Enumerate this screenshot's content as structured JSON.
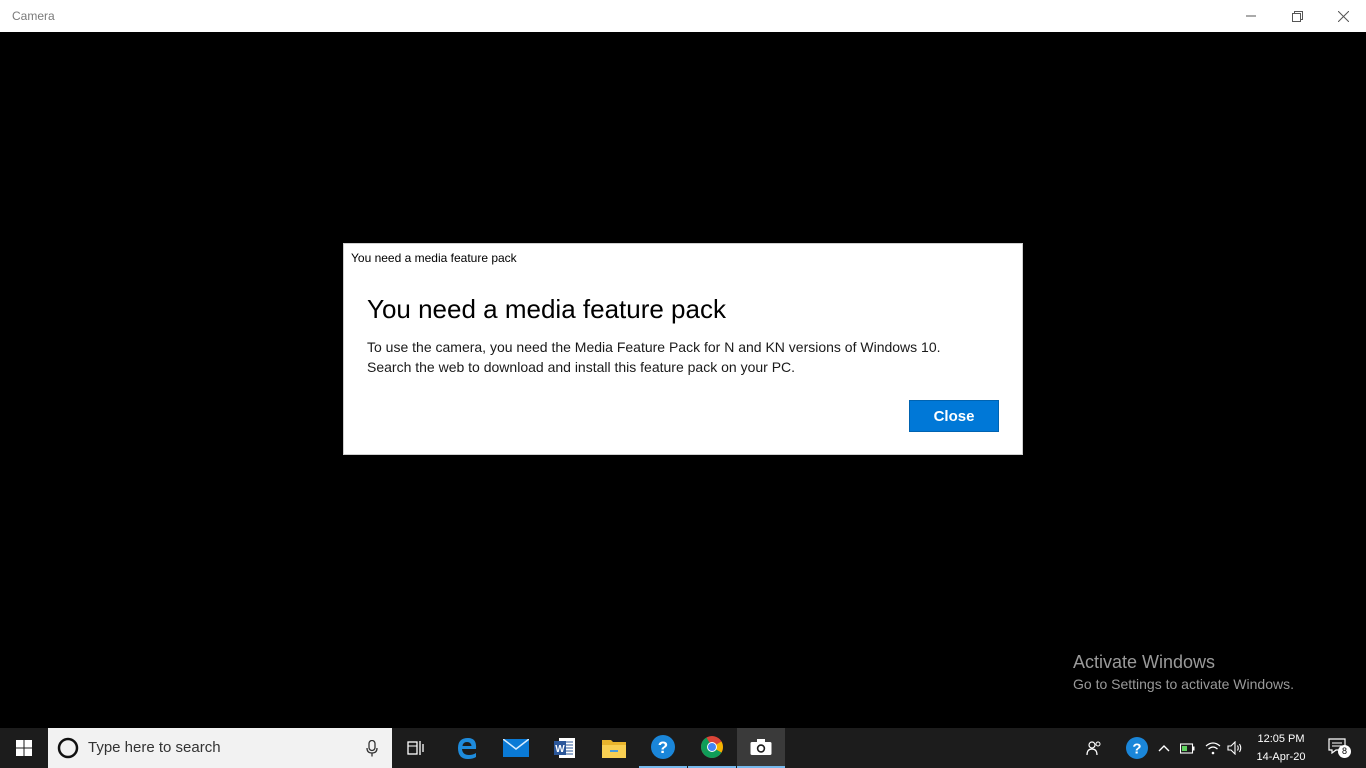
{
  "window": {
    "title": "Camera",
    "controls": {
      "minimize": "minimize-icon",
      "restore": "restore-icon",
      "close": "close-icon"
    }
  },
  "dialog": {
    "caption": "You need a media feature pack",
    "heading": "You need a media feature pack",
    "body_lines": [
      "To use the camera, you need the Media Feature Pack for N and KN versions of Windows 10.",
      "Search the web to download and install this feature pack on your PC."
    ],
    "close_label": "Close",
    "accent_color": "#0078d7"
  },
  "watermark": {
    "line1": "Activate Windows",
    "line2": "Go to Settings to activate Windows."
  },
  "taskbar": {
    "search_placeholder": "Type here to search",
    "pinned_apps": [
      "task-view-icon",
      "edge-icon",
      "mail-icon",
      "word-icon",
      "file-explorer-icon",
      "help-icon",
      "chrome-icon",
      "camera-icon"
    ],
    "active_app": "camera-icon",
    "tray_icons": [
      "people-icon",
      "help-icon",
      "chevron-up-icon",
      "battery-icon",
      "wifi-icon",
      "volume-icon"
    ],
    "time": "12:05 PM",
    "date": "14-Apr-20",
    "notification_count": "8"
  }
}
